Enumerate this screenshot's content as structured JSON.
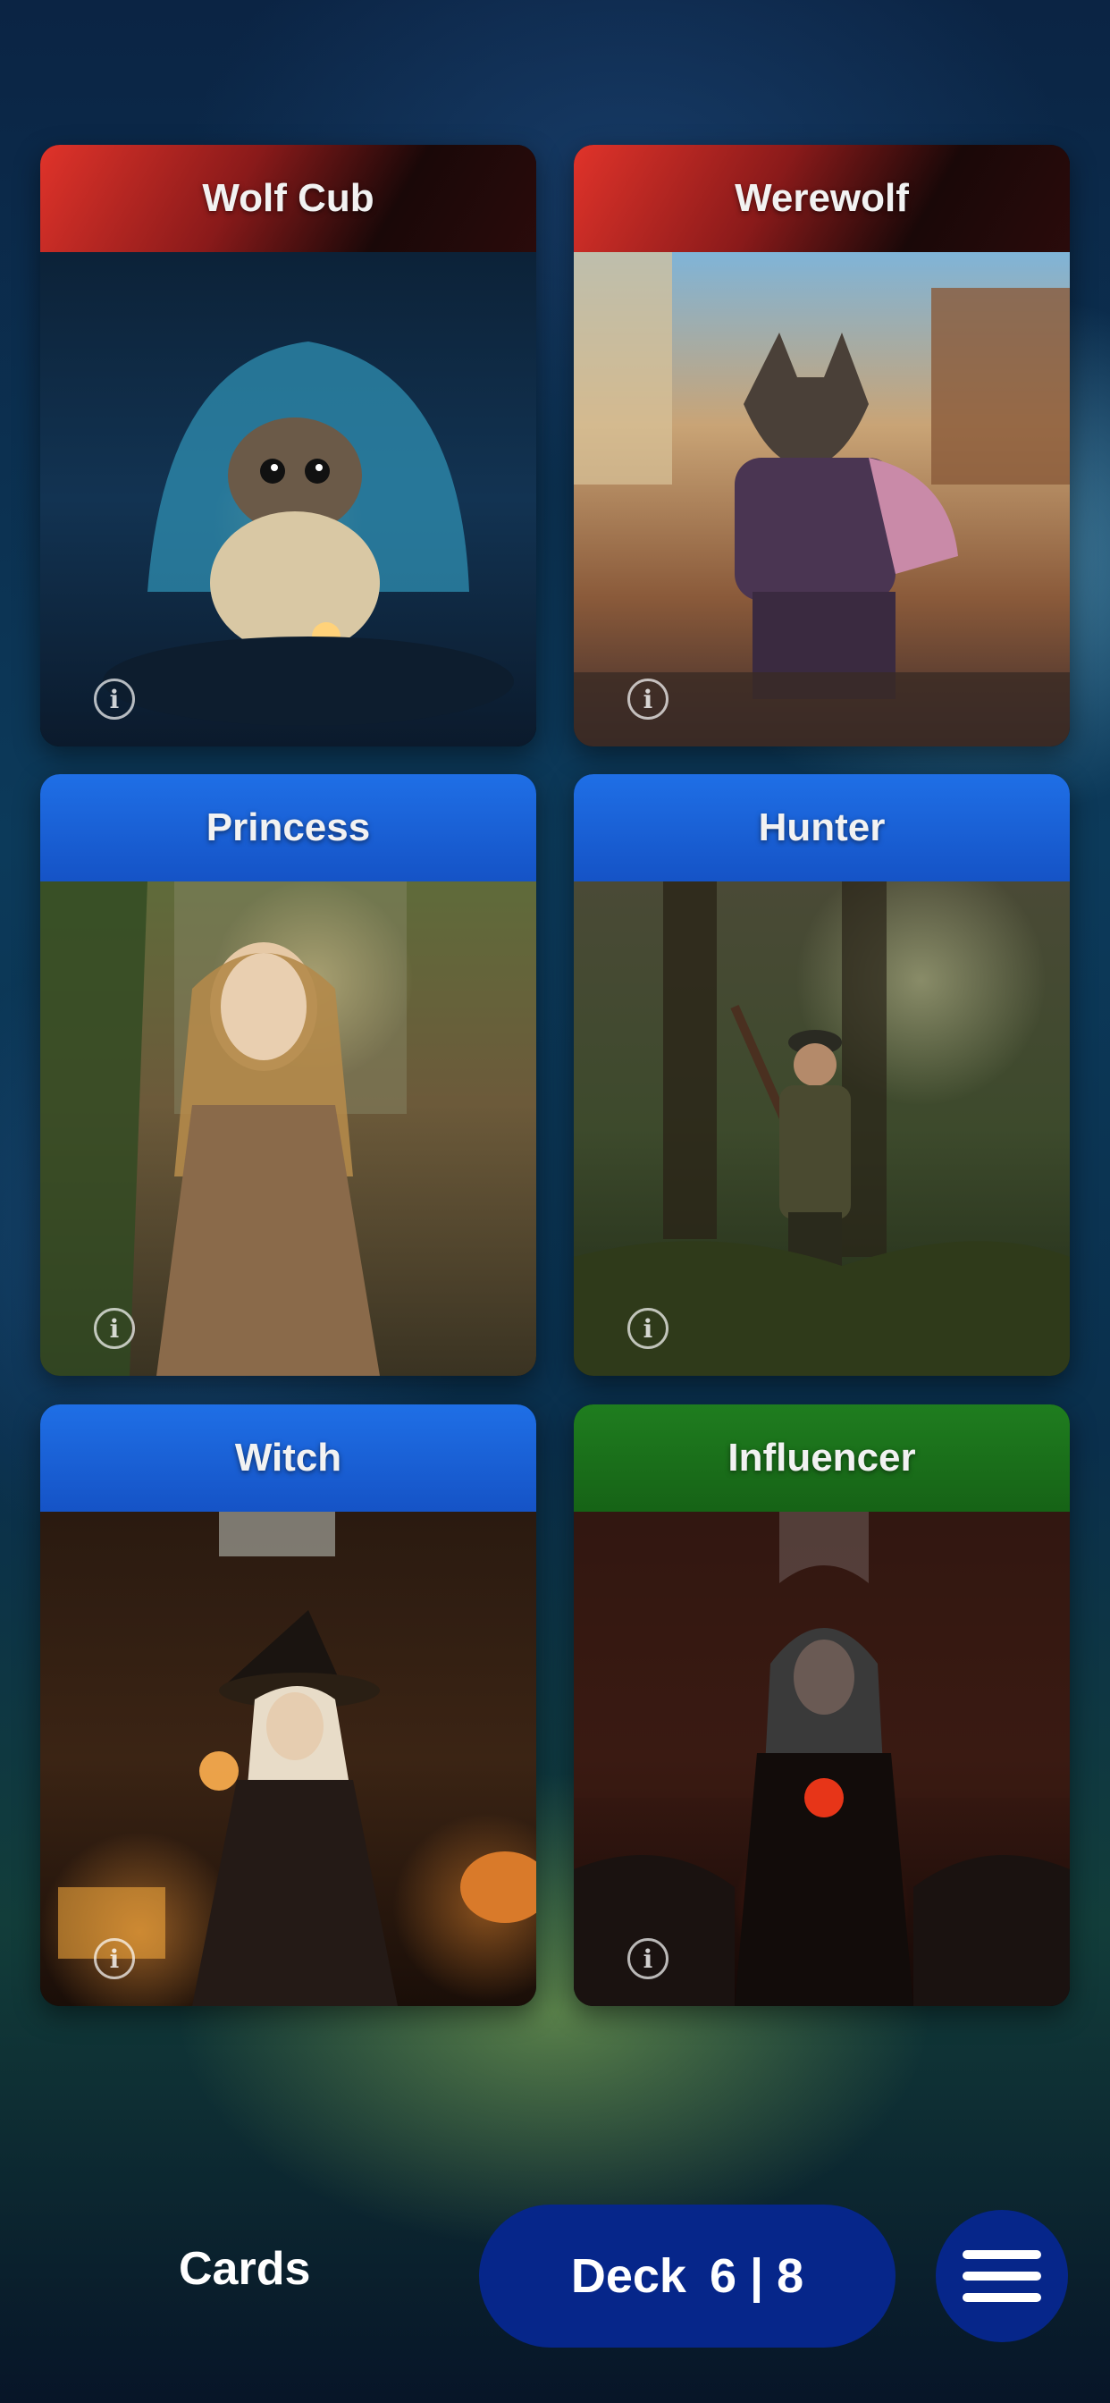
{
  "cards": [
    {
      "title": "Wolf Cub",
      "header_color": "red",
      "art": "wolf-cub-art"
    },
    {
      "title": "Werewolf",
      "header_color": "red",
      "art": "werewolf-art"
    },
    {
      "title": "Princess",
      "header_color": "blue",
      "art": "princess-art"
    },
    {
      "title": "Hunter",
      "header_color": "blue",
      "art": "hunter-art"
    },
    {
      "title": "Witch",
      "header_color": "blue",
      "art": "witch-art"
    },
    {
      "title": "Influencer",
      "header_color": "green",
      "art": "influencer-art"
    }
  ],
  "info_icon": "info-icon",
  "bottom_bar": {
    "cards_label": "Cards",
    "deck_label": "Deck",
    "deck_count": "6 | 8",
    "menu_icon": "hamburger-menu-icon"
  },
  "colors": {
    "red_header": "#e0332a",
    "blue_header": "#1f6fe6",
    "green_header": "#1f7d1f",
    "deck_button": "#06268a"
  }
}
